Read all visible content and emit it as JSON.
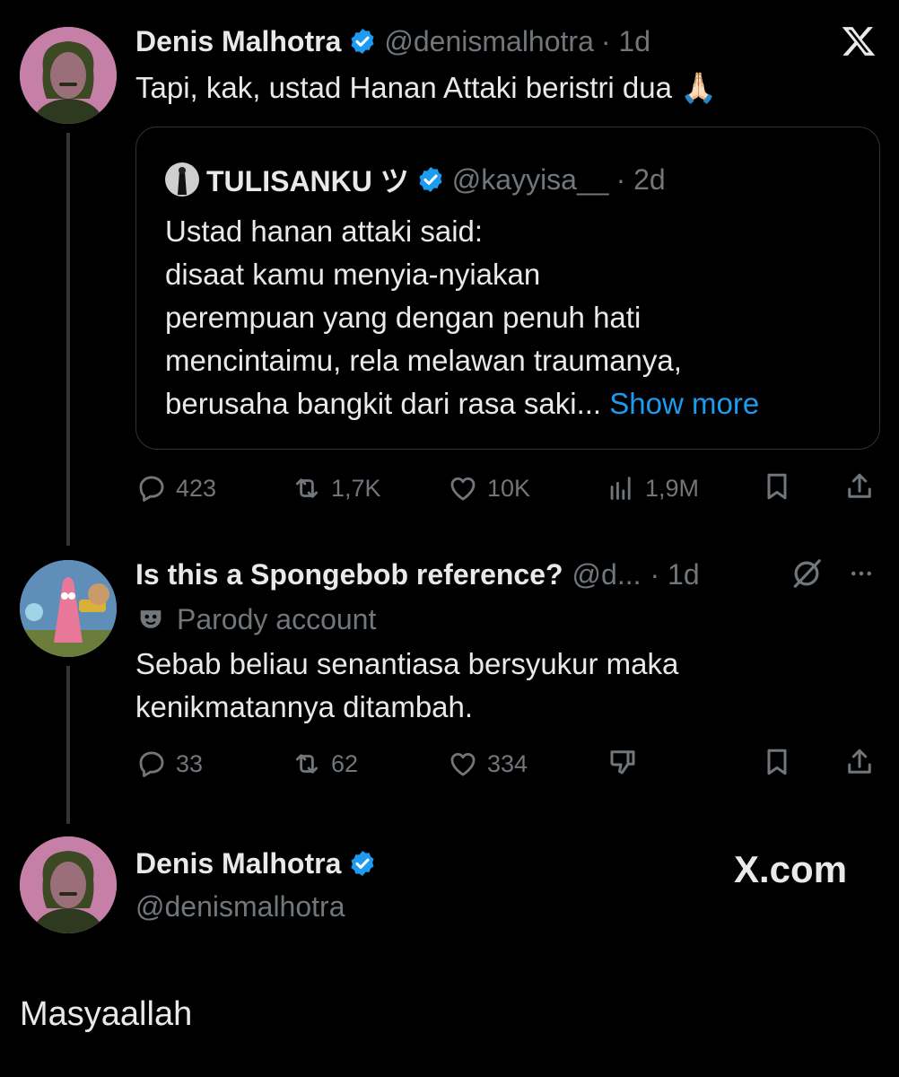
{
  "tweet1": {
    "author_name": "Denis Malhotra",
    "handle": "@denismalhotra",
    "time": "· 1d",
    "text": "Tapi, kak, ustad Hanan Attaki beristri dua",
    "emoji": "🙏🏻",
    "quote": {
      "author_name": "TULISANKU ツ",
      "handle": "@kayyisa__",
      "time": "· 2d",
      "lines": [
        "Ustad hanan attaki said:",
        "disaat kamu menyia-nyiakan",
        "perempuan yang dengan penuh hati",
        "mencintaimu, rela melawan traumanya,",
        "berusaha bangkit dari rasa saki..."
      ],
      "show_more": "Show more"
    },
    "actions": {
      "replies": "423",
      "reposts": "1,7K",
      "likes": "10K",
      "views": "1,9M"
    }
  },
  "tweet2": {
    "author_name": "Is this a Spongebob reference?",
    "handle": "@d...",
    "time": "· 1d",
    "badge": "Parody account",
    "lines": [
      "Sebab beliau senantiasa bersyukur maka",
      "kenikmatannya ditambah."
    ],
    "actions": {
      "replies": "33",
      "reposts": "62",
      "likes": "334"
    }
  },
  "tweet3": {
    "author_name": "Denis Malhotra",
    "handle": "@denismalhotra",
    "watermark": "X.com",
    "text": "Masyaallah"
  },
  "icons": {
    "close": "x-logo-icon",
    "verified": "verified-badge-icon",
    "reply": "reply-icon",
    "repost": "repost-icon",
    "like": "heart-icon",
    "views": "views-icon",
    "bookmark": "bookmark-icon",
    "share": "share-icon",
    "grok": "grok-icon",
    "more": "more-icon",
    "parody": "parody-mask-icon",
    "dislike": "dislike-icon"
  },
  "colors": {
    "background": "#000000",
    "text": "#e7e9ea",
    "muted": "#71767b",
    "accent": "#1d9bf0"
  }
}
